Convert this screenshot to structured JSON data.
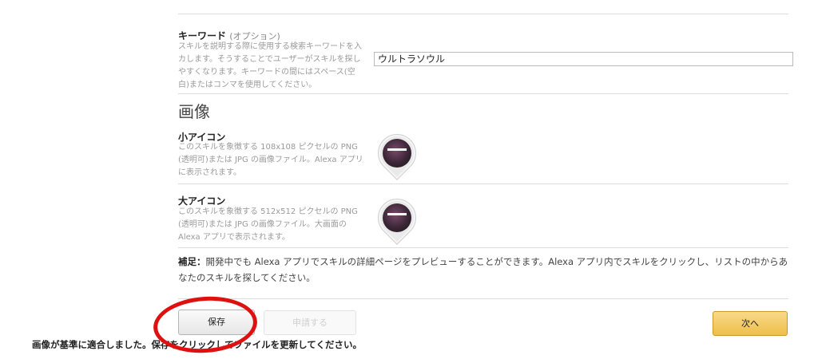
{
  "keyword": {
    "title": "キーワード",
    "optional": "(オプション)",
    "description": "スキルを説明する際に使用する検索キーワードを入\nカします。そうすることでユーザーがスキルを探し\nやすくなります。キーワードの間にはスペース(空\n白)またはコンマを使用してください。",
    "value": "ウルトラソウル"
  },
  "images": {
    "heading": "画像",
    "small": {
      "title": "小アイコン",
      "description": "このスキルを象徴する 108x108 ピクセルの PNG\n(透明可)または JPG の画像ファイル。Alexa アプリ\nに表示されます。"
    },
    "large": {
      "title": "大アイコン",
      "description": "このスキルを象徴する 512x512 ピクセルの PNG\n(透明可)または JPG の画像ファイル。大画面の\nAlexa アプリで表示されます。"
    }
  },
  "note": {
    "label": "補足：",
    "text": "開発中でも Alexa アプリでスキルの詳細ページをプレビューすることができます。Alexa アプリ内でスキルをクリックし、リストの中からあなたのスキルを探してください。"
  },
  "buttons": {
    "save": "保存",
    "apply": "申請する",
    "next": "次へ"
  },
  "status": {
    "message": "画像が基準に適合しました。保存をクリックしてファイルを更新してください。"
  },
  "colors": {
    "annotation": "#e01010",
    "next_button": "#eebf4a"
  }
}
